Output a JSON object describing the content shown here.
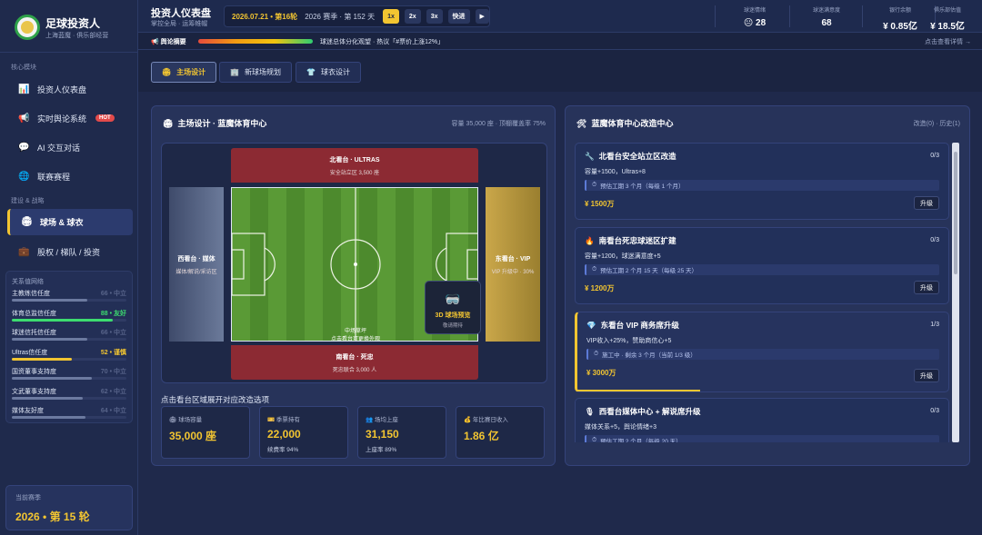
{
  "brand": {
    "title": "足球投资人",
    "subtitle": "上海蓝魔 · 俱乐部经营"
  },
  "sidebar": {
    "sections": [
      "核心模块",
      "建设 & 战略"
    ],
    "items": [
      {
        "label": "投资人仪表盘",
        "icon": "chart-icon"
      },
      {
        "label": "实时舆论系统",
        "icon": "megaphone-icon",
        "badge": "HOT"
      },
      {
        "label": "AI 交互对话",
        "icon": "chat-icon"
      },
      {
        "label": "联赛赛程",
        "icon": "globe-icon"
      },
      {
        "label": "球场 & 球衣",
        "icon": "stadium-icon",
        "active": true
      },
      {
        "label": "股权 / 梯队 / 投资",
        "icon": "briefcase-icon"
      }
    ]
  },
  "relations": {
    "title": "关系值网络",
    "rows": [
      {
        "name": "主教练信任度",
        "value": "66 • 中立",
        "level": 0.66,
        "color": "#6c7aa0"
      },
      {
        "name": "体育总监信任度",
        "value": "88 • 友好",
        "level": 0.88,
        "color": "#3ddc70"
      },
      {
        "name": "球迷信托信任度",
        "value": "66 • 中立",
        "level": 0.66,
        "color": "#6c7aa0"
      },
      {
        "name": "Ultras信任度",
        "value": "52 • 谨慎",
        "level": 0.52,
        "color": "#f2c531"
      },
      {
        "name": "国资董事支持度",
        "value": "70 • 中立",
        "level": 0.7,
        "color": "#6c7aa0"
      },
      {
        "name": "文武董事支持度",
        "value": "62 • 中立",
        "level": 0.62,
        "color": "#6c7aa0"
      },
      {
        "name": "媒体友好度",
        "value": "64 • 中立",
        "level": 0.64,
        "color": "#6c7aa0"
      }
    ]
  },
  "season": {
    "label": "当前赛季",
    "value": "2026 • 第 15 轮"
  },
  "topbar": {
    "title": "投资人仪表盘",
    "subtitle": "掌控全局 · 运筹帷幄",
    "date": "2026.07.21 • 第16轮",
    "season_day": "2026 赛季 · 第 152 天",
    "speeds": [
      "1x",
      "2x",
      "3x",
      "快进",
      "▶"
    ],
    "kpis": [
      {
        "label": "球迷情绪",
        "value": "😐 28"
      },
      {
        "label": "球迷满意度",
        "value": "68"
      },
      {
        "label": "银行余额",
        "value": "¥ 0.85亿"
      },
      {
        "label": "俱乐部估值",
        "value": "¥ 18.5亿"
      }
    ]
  },
  "newsbar": {
    "label": "📢 舆论摘要",
    "text": "球迷总体分化观望 · 热议「#票价上涨12%」",
    "more": "点击查看详情 →"
  },
  "tabs": [
    {
      "label": "主场设计",
      "icon": "🏟",
      "active": true
    },
    {
      "label": "新球场规划",
      "icon": "🏢"
    },
    {
      "label": "球衣设计",
      "icon": "👕"
    }
  ],
  "stadium": {
    "title": "主场设计 · 蓝魔体育中心",
    "info": "容量 35,000 座 · 顶棚覆盖率 75%",
    "stands": {
      "north": {
        "title": "北看台 · ULTRAS",
        "sub": "安全站立区 3,500 座"
      },
      "south": {
        "title": "南看台 · 死忠",
        "sub": "死忠联合 3,000 人"
      },
      "west": {
        "title": "西看台 · 媒体",
        "sub": "媒体/解说/采访区"
      },
      "east": {
        "title": "东看台 · VIP",
        "sub": "VIP 升级中 · 30%"
      }
    },
    "pitch_label_1": "中场草坪",
    "pitch_label_2": "点击看台可更换外观",
    "preview": {
      "title": "3D 球场预览",
      "sub": "敬请期待"
    },
    "hint": "点击看台区域展开对应改造选项",
    "stats": [
      {
        "label": "球场容量",
        "icon": "🏟",
        "value": "35,000 座",
        "sub": ""
      },
      {
        "label": "季票持有",
        "icon": "🎫",
        "value": "22,000",
        "sub": "续费率 94%"
      },
      {
        "label": "场均上座",
        "icon": "👥",
        "value": "31,150",
        "sub": "上座率 89%"
      },
      {
        "label": "年比赛日收入",
        "icon": "💰",
        "value": "1.86 亿",
        "sub": ""
      }
    ]
  },
  "upgrades": {
    "title": "蓝魔体育中心改造中心",
    "info": "改造(0) · 历史(1)",
    "items": [
      {
        "title": "北看台安全站立区改造",
        "icon": "🔧",
        "level": "0/3",
        "effect": "容量+1500，Ultras+8",
        "time": "预估工期 3 个月（每级 1 个月）",
        "cost": "¥ 1500万",
        "button": "升级",
        "current": false
      },
      {
        "title": "南看台死忠球迷区扩建",
        "icon": "🔥",
        "level": "0/3",
        "effect": "容量+1200，球迷满意度+5",
        "time": "预估工期 2 个月 15 天（每级 25 天）",
        "cost": "¥ 1200万",
        "button": "升级",
        "current": false
      },
      {
        "title": "东看台 VIP 商务席升级",
        "icon": "💎",
        "level": "1/3",
        "effect": "VIP收入+25%，赞助商信心+5",
        "time": "施工中 · 剩余 3 个月（当前 1/3 级）",
        "cost": "¥ 3000万",
        "button": "升级",
        "current": true,
        "progress": 0.33
      },
      {
        "title": "西看台媒体中心 + 解说席升级",
        "icon": "🎙",
        "level": "0/3",
        "effect": "媒体关系+5，舆论情绪+3",
        "time": "预估工期 2 个月（每级 20 天）",
        "cost": "",
        "button": "",
        "current": false
      }
    ]
  }
}
